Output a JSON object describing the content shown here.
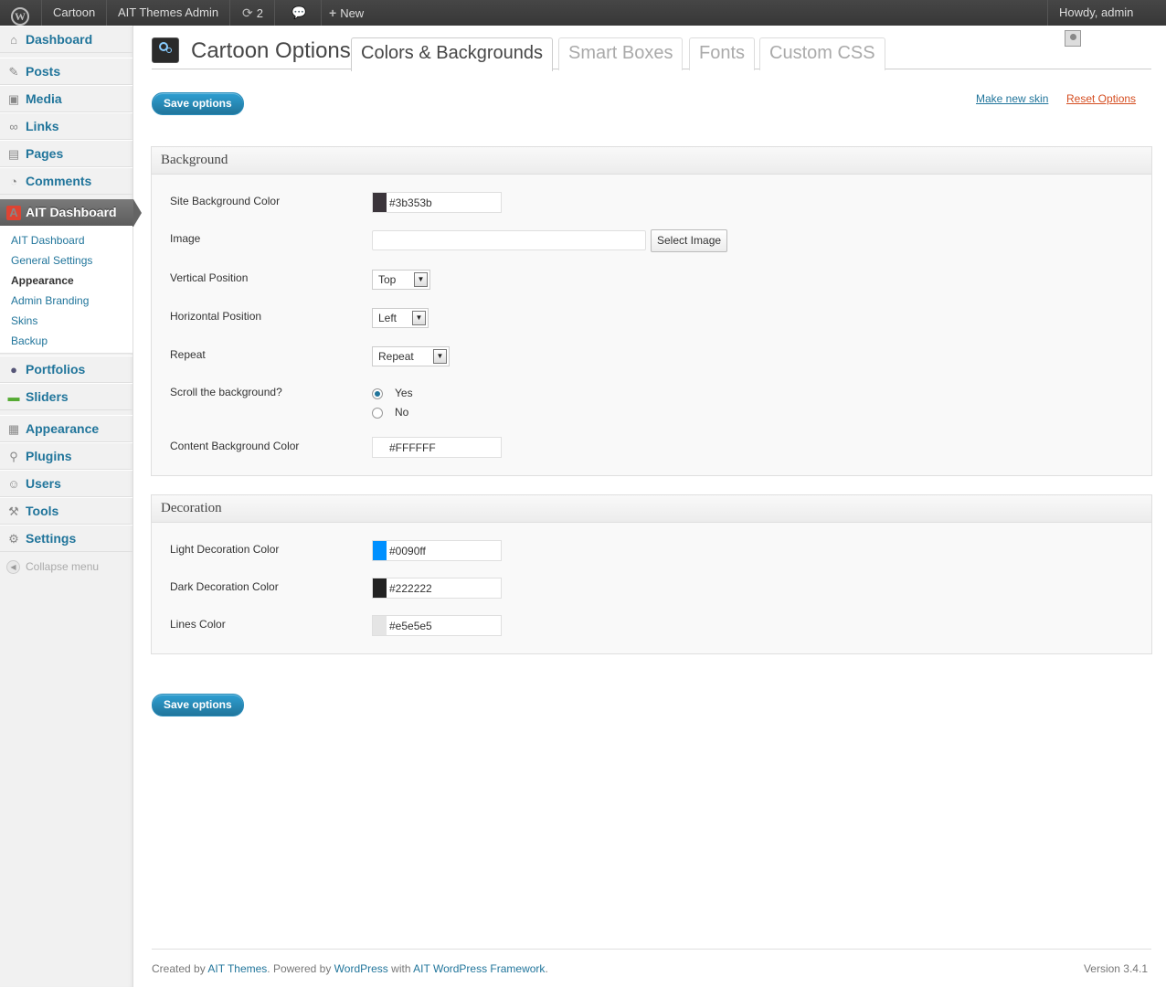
{
  "adminbar": {
    "site_name": "Cartoon",
    "themes_admin": "AIT Themes Admin",
    "updates_count": "2",
    "new_label": "New",
    "howdy": "Howdy, admin"
  },
  "sidebar": {
    "dashboard": "Dashboard",
    "posts": "Posts",
    "media": "Media",
    "links": "Links",
    "pages": "Pages",
    "comments": "Comments",
    "ait_dashboard": "AIT Dashboard",
    "submenu": [
      "AIT Dashboard",
      "General Settings",
      "Appearance",
      "Admin Branding",
      "Skins",
      "Backup"
    ],
    "portfolios": "Portfolios",
    "sliders": "Sliders",
    "appearance": "Appearance",
    "plugins": "Plugins",
    "users": "Users",
    "tools": "Tools",
    "settings": "Settings",
    "collapse": "Collapse menu"
  },
  "header": {
    "title": "Cartoon Options",
    "tabs": [
      "Colors & Backgrounds",
      "Smart Boxes",
      "Fonts",
      "Custom CSS"
    ]
  },
  "actions": {
    "save": "Save options",
    "make_skin": "Make new skin",
    "reset": "Reset Options"
  },
  "background": {
    "heading": "Background",
    "site_bg_label": "Site Background Color",
    "site_bg_value": "#3b353b",
    "image_label": "Image",
    "image_value": "",
    "select_image": "Select Image",
    "vpos_label": "Vertical Position",
    "vpos_value": "Top",
    "hpos_label": "Horizontal Position",
    "hpos_value": "Left",
    "repeat_label": "Repeat",
    "repeat_value": "Repeat",
    "scroll_label": "Scroll the background?",
    "scroll_yes": "Yes",
    "scroll_no": "No",
    "content_bg_label": "Content Background Color",
    "content_bg_value": "#FFFFFF"
  },
  "decoration": {
    "heading": "Decoration",
    "light_label": "Light Decoration Color",
    "light_value": "#0090ff",
    "dark_label": "Dark Decoration Color",
    "dark_value": "#222222",
    "lines_label": "Lines Color",
    "lines_value": "#e5e5e5"
  },
  "footer": {
    "created_by": "Created by ",
    "ait_themes": "AIT Themes",
    "powered_by": ". Powered by ",
    "wordpress": "WordPress",
    "with": " with ",
    "framework": "AIT WordPress Framework",
    "dot": ".",
    "version": "Version 3.4.1"
  },
  "colors": {
    "link": "#21759b",
    "reset_link": "#d54e21",
    "swatch_site_bg": "#3b353b",
    "swatch_light": "#0090ff",
    "swatch_dark": "#222222",
    "swatch_lines": "#e5e5e5"
  }
}
